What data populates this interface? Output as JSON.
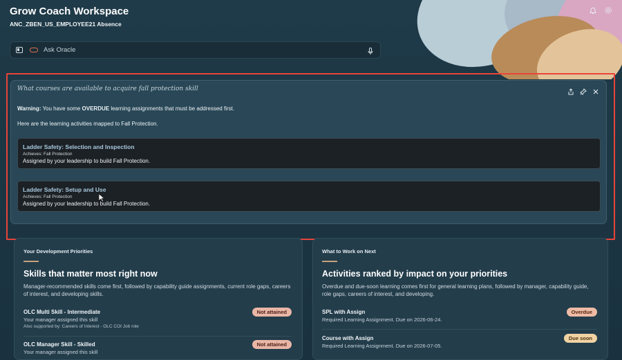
{
  "header": {
    "title": "Grow Coach Workspace",
    "subtitle": "ANC_ZBEN_US_EMPLOYEE21 Absence"
  },
  "icons": {
    "notifications": "bell-icon",
    "settings": "gear-icon"
  },
  "ask": {
    "placeholder": "Ask Oracle"
  },
  "response": {
    "query": "What courses are available to acquire fall protection skill",
    "warning_prefix": "Warning:",
    "warning_mid": " You have some ",
    "warning_emph": "OVERDUE",
    "warning_suffix": " learning assignments that must be addressed first.",
    "mapped_text": "Here are the learning activities mapped to Fall Protection.",
    "activities": [
      {
        "title": "Ladder Safety: Selection and Inspection",
        "achieves": "Achieves: Fall Protection",
        "desc": "Assigned by your leadership to build Fall Protection."
      },
      {
        "title": "Ladder Safety: Setup and Use",
        "achieves": "Achieves: Fall Protection",
        "desc": "Assigned by your leadership to build Fall Protection."
      }
    ]
  },
  "priorities": {
    "label": "Your Development Priorities",
    "heading": "Skills that matter most right now",
    "desc": "Manager-recommended skills come first, followed by capability guide assignments, current role gaps, careers of interest, and developing skills.",
    "items": [
      {
        "name": "OLC Multi Skill - Intermediate",
        "sub": "Your manager assigned this skill",
        "extra": "Also supported by: Careers of Interest - OLC COI Job role",
        "badge": "Not attained"
      },
      {
        "name": "OLC Manager Skill - Skilled",
        "sub": "Your manager assigned this skill",
        "badge": "Not attained"
      }
    ]
  },
  "next": {
    "label": "What to Work on Next",
    "heading": "Activities ranked by impact on your priorities",
    "desc": "Overdue and due-soon learning comes first for general learning plans, followed by manager, capability guide, role gaps, careers of interest, and developing.",
    "items": [
      {
        "name": "SPL with Assign",
        "sub": "Required Learning Assignment. Due on 2026-06-24.",
        "badge": "Overdue"
      },
      {
        "name": "Course with Assign",
        "sub": "Required Learning Assignment. Due on 2026-07-05.",
        "badge": "Due soon"
      }
    ]
  },
  "colors": {
    "focus_frame": "#e8443a",
    "badge_not_attained": "#e9b6a6",
    "badge_overdue": "#eebba6",
    "badge_due_soon": "#f1d3a3"
  }
}
